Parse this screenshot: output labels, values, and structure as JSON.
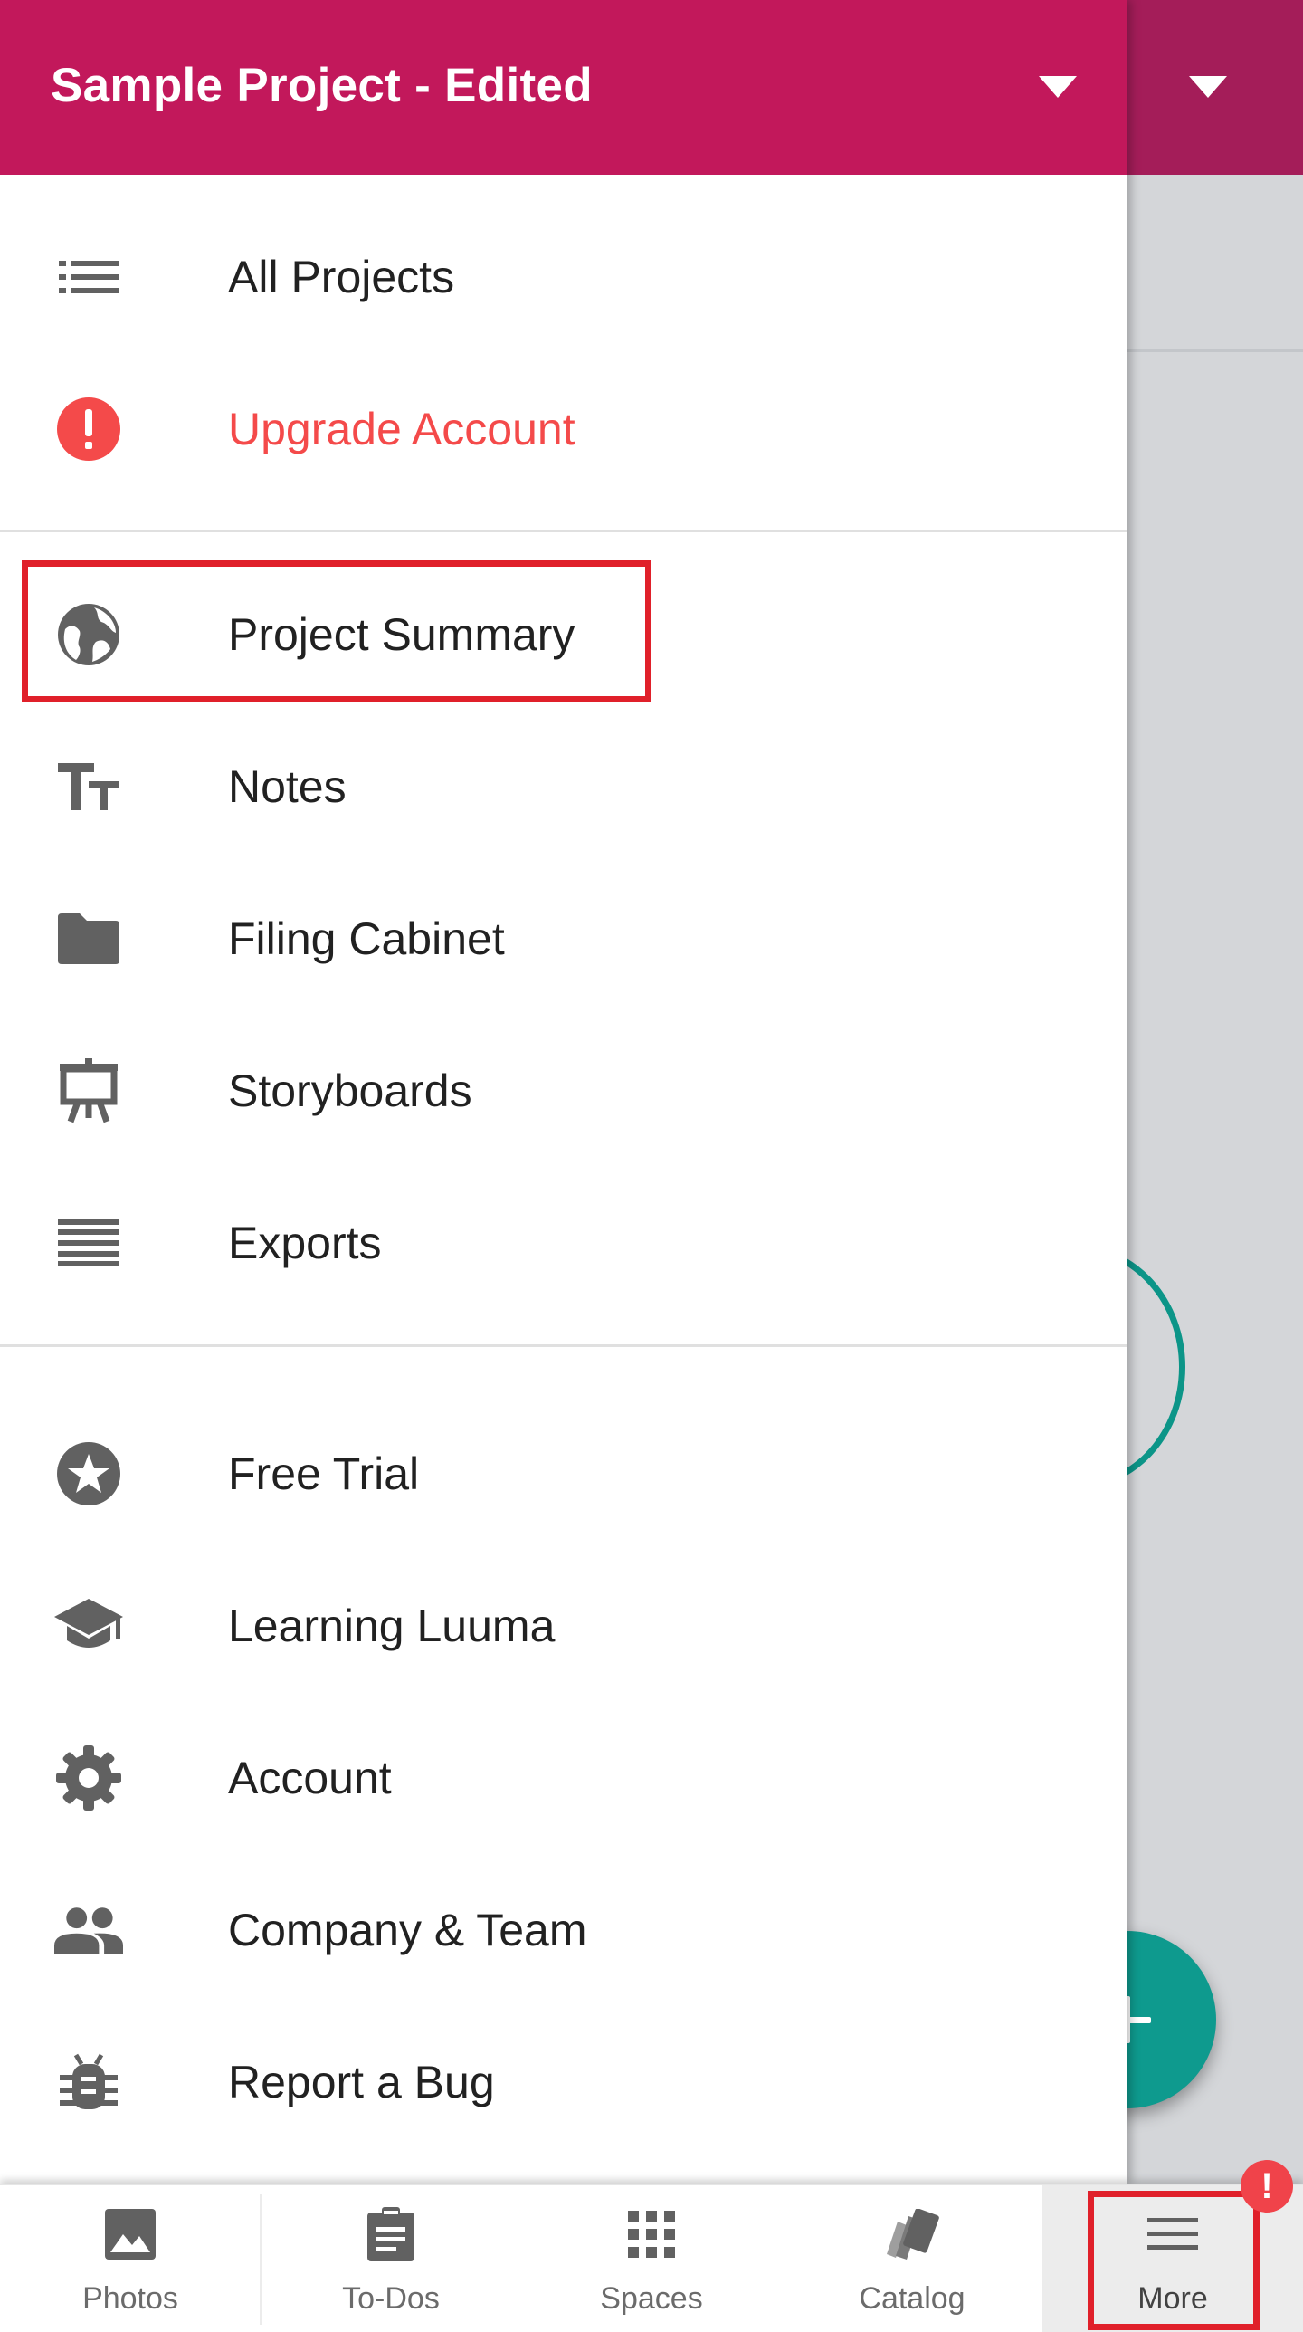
{
  "header": {
    "project_title": "Sample Project - Edited"
  },
  "drawer": {
    "group1": [
      {
        "label": "All Projects",
        "icon": "list-icon"
      },
      {
        "label": "Upgrade Account",
        "icon": "alert-icon",
        "color": "#f44a4a"
      }
    ],
    "group2": [
      {
        "label": "Project Summary",
        "icon": "globe-icon",
        "highlighted": true
      },
      {
        "label": "Notes",
        "icon": "text-size-icon"
      },
      {
        "label": "Filing Cabinet",
        "icon": "folder-icon"
      },
      {
        "label": "Storyboards",
        "icon": "easel-icon"
      },
      {
        "label": "Exports",
        "icon": "lines-icon"
      }
    ],
    "group3": [
      {
        "label": "Free Trial",
        "icon": "star-icon"
      },
      {
        "label": "Learning Luuma",
        "icon": "school-icon"
      },
      {
        "label": "Account",
        "icon": "gear-icon"
      },
      {
        "label": "Company & Team",
        "icon": "people-icon"
      },
      {
        "label": "Report a Bug",
        "icon": "bug-icon"
      }
    ]
  },
  "bottom_nav": {
    "items": [
      {
        "label": "Photos",
        "icon": "image-icon"
      },
      {
        "label": "To-Dos",
        "icon": "clipboard-icon"
      },
      {
        "label": "Spaces",
        "icon": "grid-icon"
      },
      {
        "label": "Catalog",
        "icon": "swatch-icon"
      },
      {
        "label": "More",
        "icon": "menu-icon",
        "active": true
      }
    ],
    "badge": "!"
  },
  "colors": {
    "header": "#c2185b",
    "fab": "#0e9a8e",
    "highlight": "#e0202a",
    "icon_gray": "#616161"
  }
}
